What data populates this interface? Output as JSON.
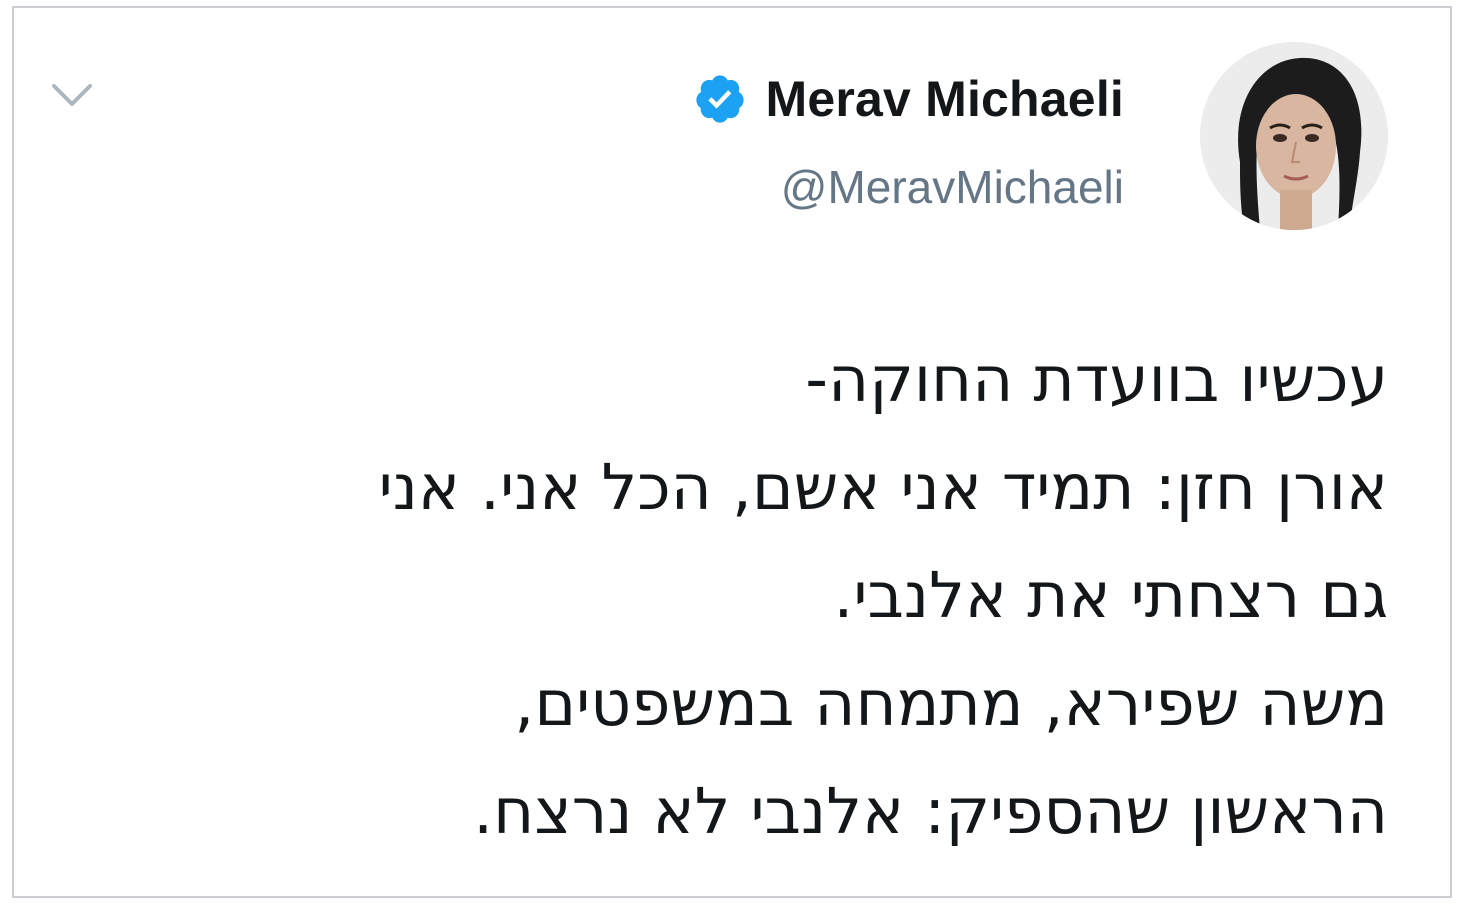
{
  "tweet": {
    "author": {
      "display_name": "Merav Michaeli",
      "handle": "@MeravMichaeli",
      "verified": true,
      "avatar_icon": "profile-photo"
    },
    "menu_icon": "chevron-down-icon",
    "text_lines": [
      "עכשיו בוועדת החוקה-",
      "אורן חזן: תמיד אני אשם, הכל אני. אני",
      "גם רצחתי את אלנבי.",
      "משה שפירא, מתמחה במשפטים,",
      "הראשון שהספיק: אלנבי לא נרצח."
    ]
  },
  "colors": {
    "verified_badge": "#1da1f2",
    "text": "#14171a",
    "secondary_text": "#657786",
    "chevron": "#aab8c2",
    "border": "#c9cdd1"
  }
}
